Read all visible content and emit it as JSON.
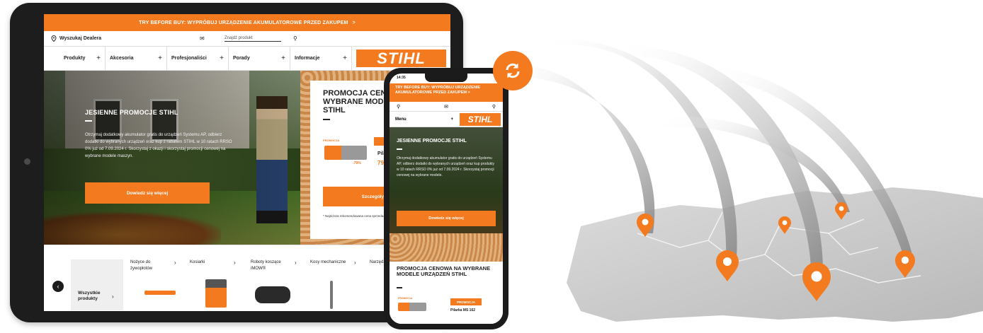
{
  "tablet": {
    "promo_bar": "TRY BEFORE BUY: WYPRÓBUJ URZĄDZENIE AKUMULATOROWE PRZED ZAKUPEM",
    "promo_chevron": ">",
    "dealer_label": "Wyszukaj Dealera",
    "search_placeholder": "Znajdź produkt",
    "nav": [
      {
        "label": "Produkty"
      },
      {
        "label": "Akcesoria"
      },
      {
        "label": "Profesjonaliści"
      },
      {
        "label": "Porady"
      },
      {
        "label": "Informacje"
      }
    ],
    "logo": "STIHL",
    "hero": {
      "title": "JESIENNE PROMOCJE STIHL",
      "text": "Otrzymaj dodatkowy akumulator gratis do urządzeń Systemu AP, odbierz dodatki do wybranych urządzeń oraz kup z rabatem STIHL w 10 ratach RRSO 0% już od 7.09.2024 r. Skorzystaj z okazji i skorzystaj promocji cenowej na wybrane modele maszyn.",
      "button": "Dowiedz się więcej"
    },
    "promo_card": {
      "title": "PROMOCJA CENOWA NA WYBRANE MODELE URZĄDZEŃ STIHL",
      "badge": "PROMOCJA",
      "product": "Pilarka MS 162",
      "pct": "-79%",
      "price": "79",
      "button": "Szczegóły promocji",
      "note": "* Najniższa rekomendowana cena sprzedaży z ostatnich 30 dni przed obniżką."
    },
    "carousel": {
      "all_label": "Wszystkie produkty",
      "items": [
        {
          "label": "Nożyce do żywopłotów"
        },
        {
          "label": "Kosiarki"
        },
        {
          "label": "Roboty koszące iMOW®"
        },
        {
          "label": "Kosy mechaniczne"
        },
        {
          "label": "Narzędzia akcesor"
        }
      ]
    }
  },
  "phone": {
    "time": "14:35",
    "promo_bar": "TRY BEFORE BUY: WYPRÓBUJ URZĄDZENIE AKUMULATOROWE PRZED ZAKUPEM >",
    "menu_label": "Menu",
    "logo": "STIHL",
    "hero_title": "JESIENNE PROMOCJE STIHL",
    "hero_text": "Otrzymaj dodatkowy akumulator gratis do urządzeń Systemu AP, odbierz dodatki do wybranych urządzeń oraz kup produkty w 10 ratach RRSO 0% już od 7.09.2024 r. Skorzystaj promocji cenowej na wybrane modele.",
    "hero_button": "Dowiedz się więcej",
    "promo_title": "PROMOCJA CENOWA NA WYBRANE MODELE URZĄDZEŃ STIHL",
    "promo_badge": "PROMOCJA",
    "promo_small": "PROMOCJA",
    "product": "Pilarka MS 162"
  },
  "colors": {
    "brand_orange": "#f37a1f",
    "device_dark": "#1d1d1d",
    "map_grey": "#c8c8c8"
  },
  "icons": [
    "location-pin-icon",
    "mail-icon",
    "search-icon",
    "plus-icon",
    "chevron-right-icon",
    "chevron-left-icon",
    "sync-icon",
    "map-marker-icon"
  ]
}
